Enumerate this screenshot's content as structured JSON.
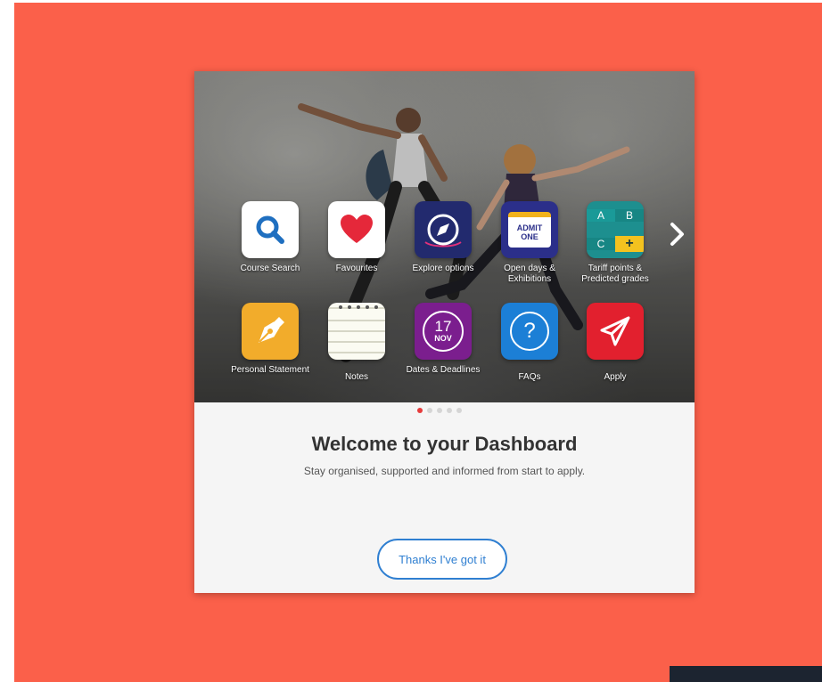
{
  "tiles": [
    {
      "label": "Course Search"
    },
    {
      "label": "Favourites"
    },
    {
      "label": "Explore options"
    },
    {
      "label": "Open days & Exhibitions",
      "icon_text_1": "ADMIT",
      "icon_text_2": "ONE"
    },
    {
      "label": "Tariff points & Predicted grades",
      "icon_text_a": "A",
      "icon_text_b": "B",
      "icon_text_c": "C",
      "icon_text_plus": "+"
    },
    {
      "label": "Personal Statement"
    },
    {
      "label": "Notes"
    },
    {
      "label": "Dates & Deadlines",
      "icon_day": "17",
      "icon_month": "NOV"
    },
    {
      "label": "FAQs",
      "icon_text": "?"
    },
    {
      "label": "Apply"
    }
  ],
  "welcome": {
    "title": "Welcome to your Dashboard",
    "subtitle": "Stay organised, supported and informed from start to apply."
  },
  "button": {
    "label": "Thanks I've got it"
  },
  "pagination": {
    "total": 5,
    "active": 1
  },
  "colors": {
    "backdrop": "#fb604a",
    "accent_blue": "#2f7fd1",
    "active_dot": "#e63b3b"
  }
}
